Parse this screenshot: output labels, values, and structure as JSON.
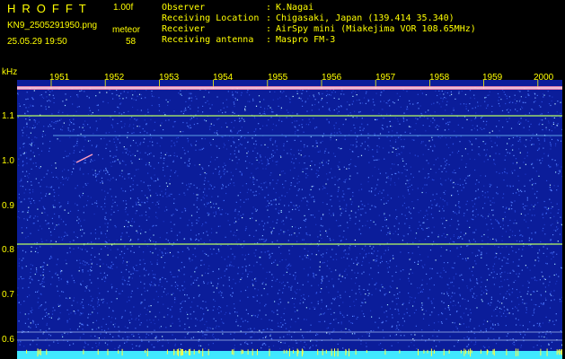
{
  "header": {
    "app_title": "HROFFT",
    "version": "1.00f",
    "filename": "KN9_2505291950.png",
    "datetime": "25.05.29 19:50",
    "meteor_label": "meteor",
    "meteor_count": "58"
  },
  "info": [
    {
      "label": "Observer",
      "value": "K.Nagai"
    },
    {
      "label": "Receiving Location",
      "value": "Chigasaki, Japan (139.414 35.340)"
    },
    {
      "label": "Receiver",
      "value": "AirSpy mini (Miakejima VOR 108.65MHz)"
    },
    {
      "label": "Receiving antenna",
      "value": "Maspro FM-3"
    }
  ],
  "colon": ":",
  "axis": {
    "unit": "kHz",
    "freq_ticks": [
      "1.1",
      "1.0",
      "0.9",
      "0.8",
      "0.7",
      "0.6"
    ],
    "time_ticks": [
      "1951",
      "1952",
      "1953",
      "1954",
      "1955",
      "1956",
      "1957",
      "1958",
      "1959",
      "2000"
    ]
  },
  "colors": {
    "text": "#ffff00",
    "spectrogram_bg": "#0b1d9a",
    "signal_line": "#b8ff60",
    "bottom_band": "#40e8ff"
  }
}
